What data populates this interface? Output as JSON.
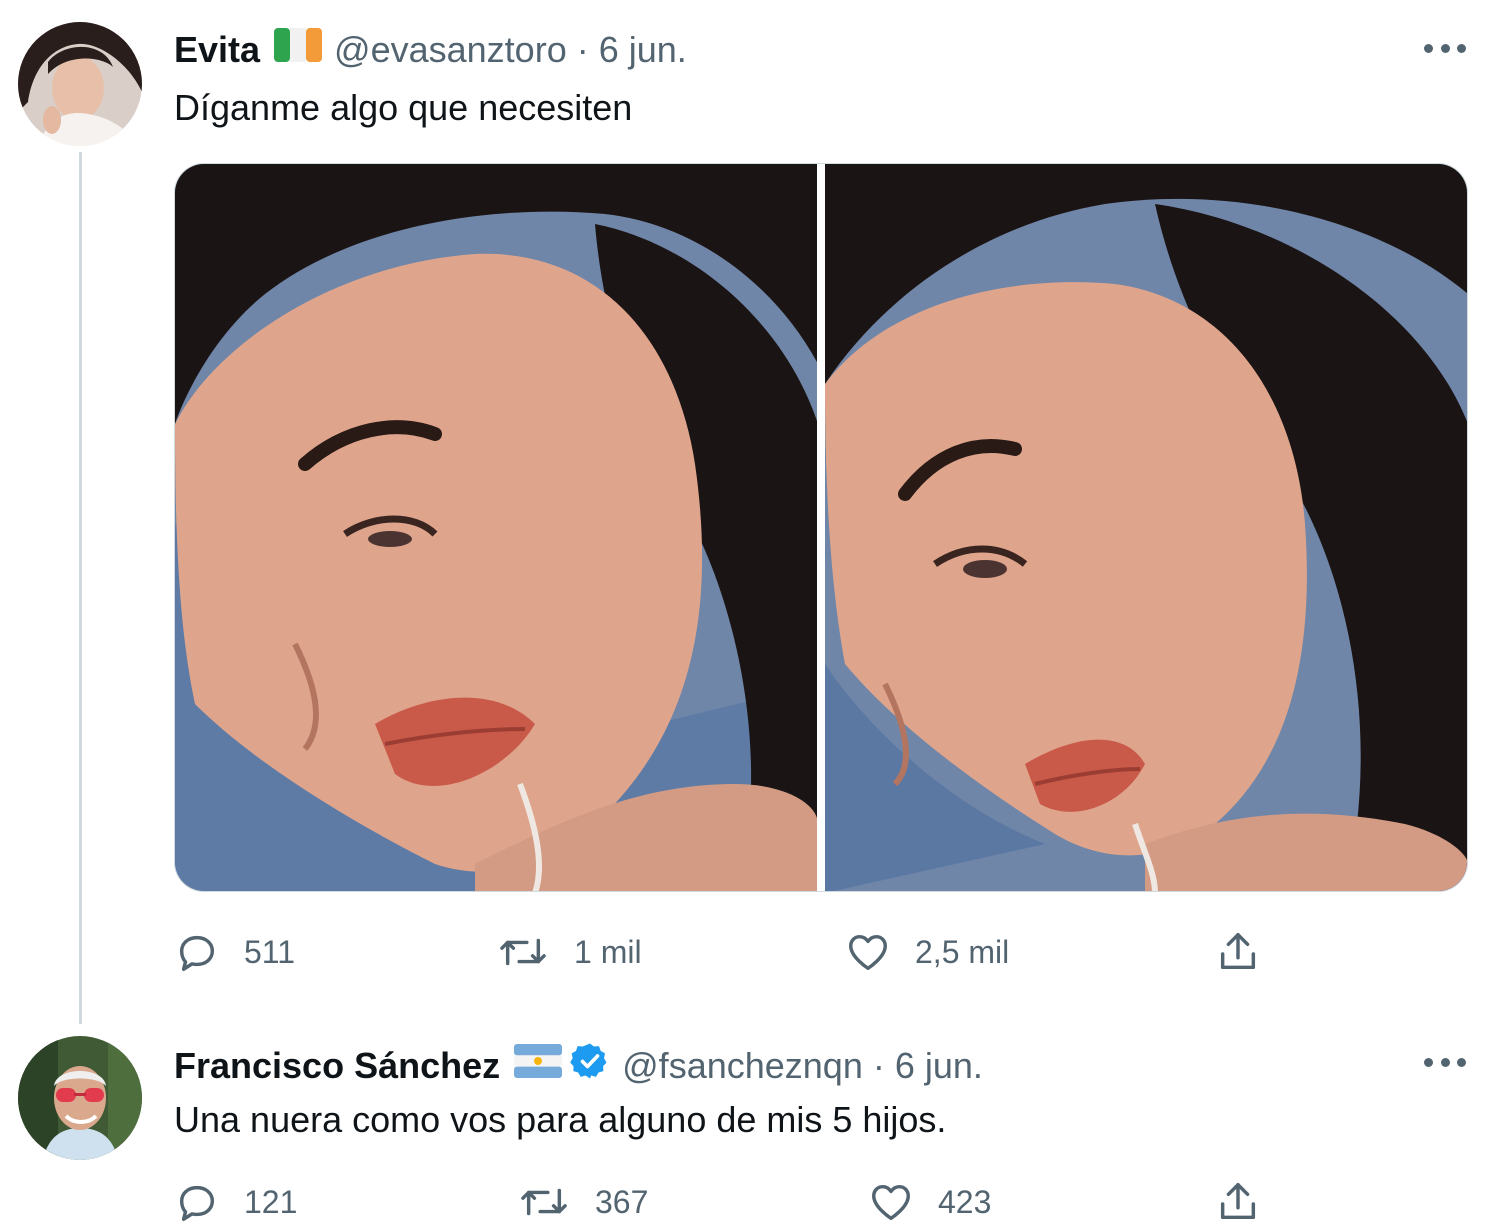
{
  "tweets": [
    {
      "author": {
        "name": "Evita",
        "flag": "irish-flag",
        "handle": "@evasanztoro",
        "separator": "·",
        "date": "6 jun."
      },
      "text": "Díganme algo que necesiten",
      "media": [
        "photo-selfie-left",
        "photo-selfie-right"
      ],
      "stats": {
        "replies": "511",
        "retweets": "1 mil",
        "likes": "2,5 mil"
      }
    },
    {
      "author": {
        "name": "Francisco Sánchez",
        "flag": "argentina-flag",
        "verified": true,
        "handle": "@fsancheznqn",
        "separator": "·",
        "date": "6 jun."
      },
      "text": "Una nuera como vos para alguno de mis 5 hijos.",
      "stats": {
        "replies": "121",
        "retweets": "367",
        "likes": "423"
      }
    }
  ],
  "colors": {
    "text": "#0f1419",
    "secondary": "#536471",
    "verified": "#1d9bf0",
    "thread_line": "#cfd9de"
  }
}
